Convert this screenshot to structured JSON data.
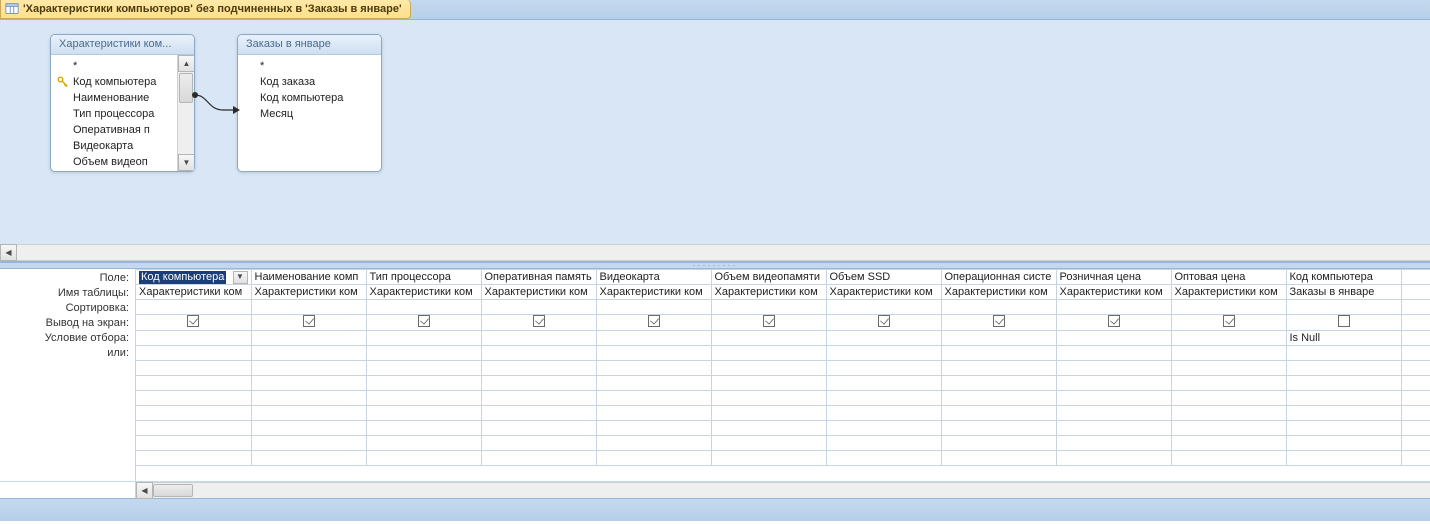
{
  "title": "'Характеристики компьютеров' без подчиненных в 'Заказы в январе'",
  "tables": {
    "left": {
      "title": "Характеристики ком...",
      "fields": [
        "*",
        "Код компьютера",
        "Наименование",
        "Тип процессора",
        "Оперативная п",
        "Видеокарта",
        "Объем видеоп"
      ],
      "keyIndex": 1,
      "hasScrollbar": true
    },
    "right": {
      "title": "Заказы в январе",
      "fields": [
        "*",
        "Код заказа",
        "Код компьютера",
        "Месяц"
      ],
      "hasScrollbar": false
    }
  },
  "rowLabels": {
    "field": "Поле:",
    "table": "Имя таблицы:",
    "sort": "Сортировка:",
    "show": "Вывод на экран:",
    "criteria": "Условие отбора:",
    "or": "или:"
  },
  "columns": [
    {
      "field": "Код компьютера",
      "table": "Характеристики ком",
      "show": true,
      "criteria": "",
      "selected": true
    },
    {
      "field": "Наименование комп",
      "table": "Характеристики ком",
      "show": true,
      "criteria": ""
    },
    {
      "field": "Тип процессора",
      "table": "Характеристики ком",
      "show": true,
      "criteria": ""
    },
    {
      "field": "Оперативная память",
      "table": "Характеристики ком",
      "show": true,
      "criteria": ""
    },
    {
      "field": "Видеокарта",
      "table": "Характеристики ком",
      "show": true,
      "criteria": ""
    },
    {
      "field": "Объем видеопамяти",
      "table": "Характеристики ком",
      "show": true,
      "criteria": ""
    },
    {
      "field": "Объем SSD",
      "table": "Характеристики ком",
      "show": true,
      "criteria": ""
    },
    {
      "field": "Операционная систе",
      "table": "Характеристики ком",
      "show": true,
      "criteria": ""
    },
    {
      "field": "Розничная цена",
      "table": "Характеристики ком",
      "show": true,
      "criteria": ""
    },
    {
      "field": "Оптовая цена",
      "table": "Характеристики ком",
      "show": true,
      "criteria": ""
    },
    {
      "field": "Код компьютера",
      "table": "Заказы в январе",
      "show": false,
      "criteria": "Is Null"
    }
  ]
}
